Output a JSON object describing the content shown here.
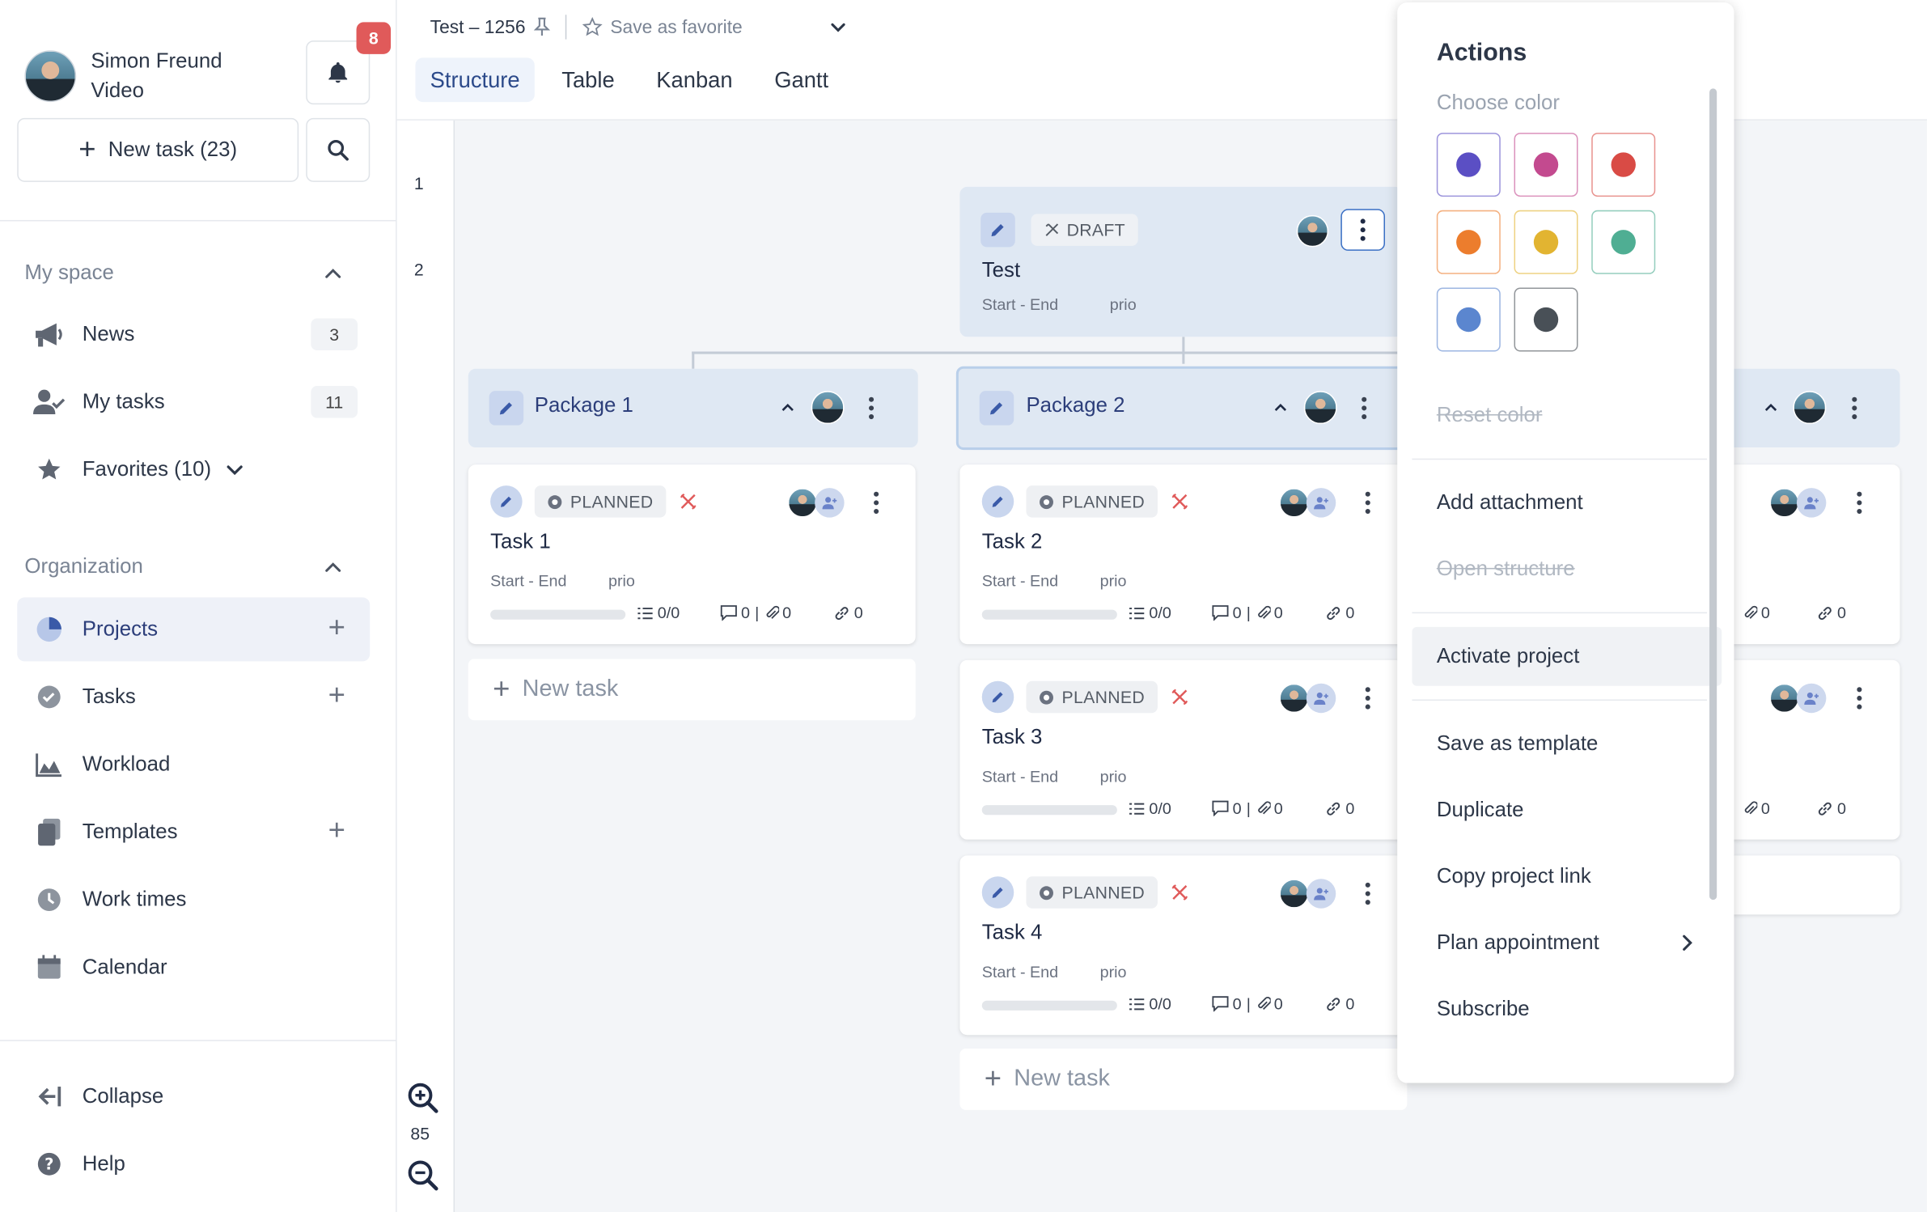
{
  "user": {
    "name": "Simon Freund",
    "role": "Video"
  },
  "notifications": {
    "count": "8"
  },
  "sidebar": {
    "new_task_label": "New task (23)",
    "my_space": {
      "title": "My space",
      "items": [
        {
          "label": "News",
          "badge": "3"
        },
        {
          "label": "My tasks",
          "badge": "11"
        },
        {
          "label": "Favorites (10)"
        }
      ]
    },
    "organization": {
      "title": "Organization",
      "items": [
        {
          "label": "Projects"
        },
        {
          "label": "Tasks"
        },
        {
          "label": "Workload"
        },
        {
          "label": "Templates"
        },
        {
          "label": "Work times"
        },
        {
          "label": "Calendar"
        }
      ]
    },
    "footer": {
      "collapse": "Collapse",
      "help": "Help"
    }
  },
  "header": {
    "breadcrumb": "Test – 1256",
    "favorite": "Save as favorite",
    "tabs": [
      "Structure",
      "Table",
      "Kanban",
      "Gantt"
    ]
  },
  "canvas": {
    "rows": [
      "1",
      "2"
    ],
    "zoom": "85",
    "project": {
      "status": "DRAFT",
      "title": "Test",
      "dates": "Start - End",
      "prio": "prio"
    },
    "packages": [
      {
        "title": "Package 1"
      },
      {
        "title": "Package 2"
      }
    ],
    "tasks": [
      {
        "status": "PLANNED",
        "title": "Task 1",
        "dates": "Start - End",
        "prio": "prio",
        "checklist": "0/0",
        "comments": "0",
        "attachments": "0",
        "links": "0"
      },
      {
        "status": "PLANNED",
        "title": "Task 2",
        "dates": "Start - End",
        "prio": "prio",
        "checklist": "0/0",
        "comments": "0",
        "attachments": "0",
        "links": "0"
      },
      {
        "status": "PLANNED",
        "title": "Task 3",
        "dates": "Start - End",
        "prio": "prio",
        "checklist": "0/0",
        "comments": "0",
        "attachments": "0",
        "links": "0"
      },
      {
        "status": "PLANNED",
        "title": "Task 4",
        "dates": "Start - End",
        "prio": "prio",
        "checklist": "0/0",
        "comments": "0",
        "attachments": "0",
        "links": "0"
      }
    ],
    "new_task": "New task",
    "partial_counts": {
      "attachments": "0",
      "links": "0"
    }
  },
  "actions_menu": {
    "title": "Actions",
    "choose_color": "Choose color",
    "colors": [
      "#5b4fc4",
      "#c34a8f",
      "#d94b45",
      "#ec7d2d",
      "#e2b431",
      "#4fae93",
      "#5b86cf",
      "#495057"
    ],
    "reset_color": "Reset color",
    "items": {
      "add_attachment": "Add attachment",
      "open_structure": "Open structure",
      "activate_project": "Activate project",
      "save_as_template": "Save as template",
      "duplicate": "Duplicate",
      "copy_project_link": "Copy project link",
      "plan_appointment": "Plan appointment",
      "subscribe": "Subscribe"
    }
  }
}
